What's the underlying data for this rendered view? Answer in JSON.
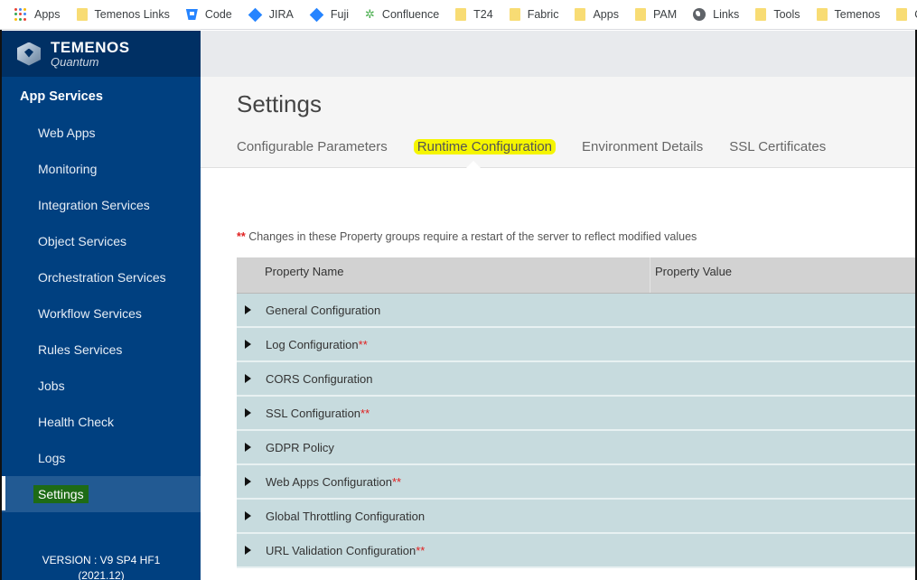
{
  "bookmarks": [
    {
      "label": "Apps",
      "icon": "apps-grid-icon"
    },
    {
      "label": "Temenos Links",
      "icon": "folder-icon"
    },
    {
      "label": "Code",
      "icon": "bitbucket-icon"
    },
    {
      "label": "JIRA",
      "icon": "jira-icon"
    },
    {
      "label": "Fuji",
      "icon": "jira-icon"
    },
    {
      "label": "Confluence",
      "icon": "confluence-icon"
    },
    {
      "label": "T24",
      "icon": "folder-icon"
    },
    {
      "label": "Fabric",
      "icon": "folder-icon"
    },
    {
      "label": "Apps",
      "icon": "folder-icon"
    },
    {
      "label": "PAM",
      "icon": "folder-icon"
    },
    {
      "label": "Links",
      "icon": "globe-icon"
    },
    {
      "label": "Tools",
      "icon": "folder-icon"
    },
    {
      "label": "Temenos",
      "icon": "folder-icon"
    },
    {
      "label": "Ot",
      "icon": "folder-icon"
    }
  ],
  "brand": {
    "name": "TEMENOS",
    "sub": "Quantum"
  },
  "sidebar": {
    "section_title": "App Services",
    "items": [
      {
        "label": "Web Apps"
      },
      {
        "label": "Monitoring"
      },
      {
        "label": "Integration Services"
      },
      {
        "label": "Object Services"
      },
      {
        "label": "Orchestration Services"
      },
      {
        "label": "Workflow Services"
      },
      {
        "label": "Rules Services"
      },
      {
        "label": "Jobs"
      },
      {
        "label": "Health Check"
      },
      {
        "label": "Logs"
      },
      {
        "label": "Settings"
      }
    ],
    "version_line1": "VERSION : V9 SP4 HF1",
    "version_line2": "(2021.12)"
  },
  "page": {
    "title": "Settings",
    "tabs": [
      {
        "label": "Configurable Parameters"
      },
      {
        "label": "Runtime Configuration"
      },
      {
        "label": "Environment Details"
      },
      {
        "label": "SSL Certificates"
      }
    ],
    "active_tab": "Runtime Configuration",
    "note_marker": "**",
    "note_text": " Changes in these Property groups require a restart of the server to reflect modified values"
  },
  "table": {
    "headers": {
      "name": "Property Name",
      "value": "Property Value"
    },
    "rows": [
      {
        "label": "General Configuration",
        "restart": ""
      },
      {
        "label": "Log Configuration",
        "restart": "**"
      },
      {
        "label": "CORS Configuration",
        "restart": ""
      },
      {
        "label": "SSL Configuration",
        "restart": "**"
      },
      {
        "label": "GDPR Policy",
        "restart": ""
      },
      {
        "label": "Web Apps Configuration",
        "restart": "**"
      },
      {
        "label": "Global Throttling Configuration",
        "restart": ""
      },
      {
        "label": "URL Validation Configuration",
        "restart": "**"
      }
    ]
  },
  "colors": {
    "sidebar_bg": "#004080",
    "brand_bg": "#003064",
    "active_item_bg": "#225a93",
    "tab_highlight": "#f5f500",
    "settings_highlight": "#1e6b16",
    "row_bg": "#c7dbde",
    "header_bg": "#d2d2d2",
    "restart_marker": "#e02020"
  }
}
